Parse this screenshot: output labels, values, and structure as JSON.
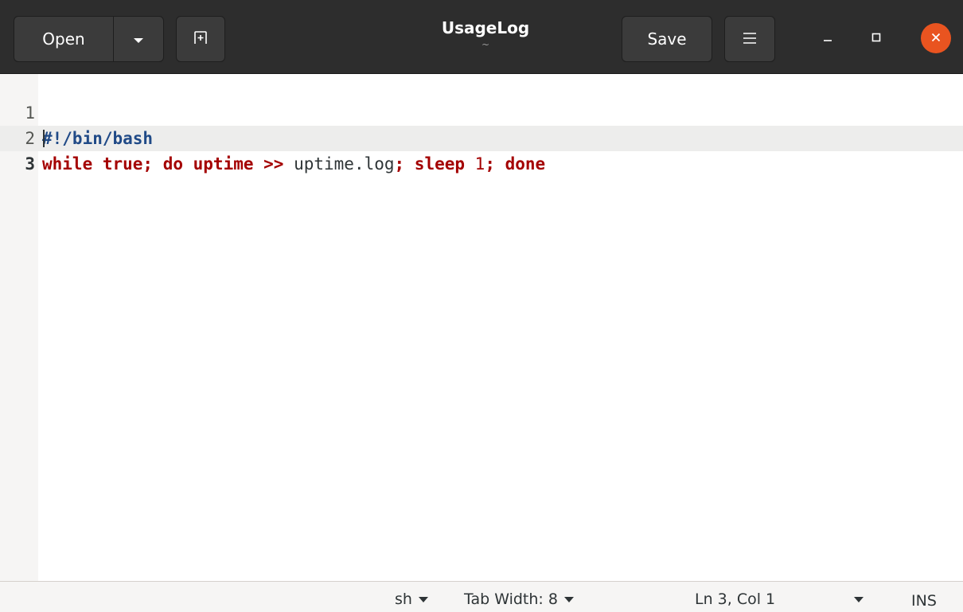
{
  "window": {
    "title": "UsageLog",
    "subtitle": "~"
  },
  "header": {
    "open_label": "Open",
    "save_label": "Save",
    "open_menu_icon": "chevron-down-icon",
    "new_tab_icon": "new-tab-icon",
    "hamburger_icon": "hamburger-menu-icon",
    "accent_close": "#e95420"
  },
  "editor": {
    "lines": [
      {
        "number": "1",
        "tokens": [
          {
            "type": "shebang",
            "text": "#!/bin/bash"
          }
        ]
      },
      {
        "number": "2",
        "tokens": [
          {
            "type": "kw",
            "text": "while true; do uptime >>"
          },
          {
            "type": "plain",
            "text": " uptime.log"
          },
          {
            "type": "kw",
            "text": "; sleep "
          },
          {
            "type": "num",
            "text": "1"
          },
          {
            "type": "kw",
            "text": "; done"
          }
        ]
      },
      {
        "number": "3",
        "tokens": []
      }
    ],
    "current_line": 3
  },
  "statusbar": {
    "language": "sh",
    "tab_width": "Tab Width: 8",
    "position": "Ln 3, Col 1",
    "mode": "INS"
  }
}
